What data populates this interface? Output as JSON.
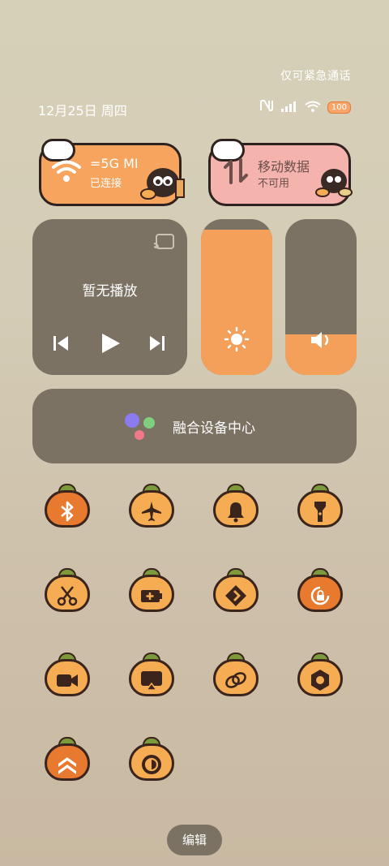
{
  "status_bar": {
    "emergency_text": "仅可紧急通话",
    "date": "12月25日 周四",
    "battery": "100",
    "icons": [
      "nfc-icon",
      "signal-icon",
      "wifi-icon",
      "battery-icon"
    ]
  },
  "wifi_tile": {
    "name": "=5G   MI",
    "status": "已连接"
  },
  "data_tile": {
    "name": "移动数据",
    "status": "不可用"
  },
  "media": {
    "label": "暂无播放"
  },
  "sliders": {
    "brightness_level": 0.93,
    "volume_level": 0.26
  },
  "device_center": {
    "label": "融合设备中心"
  },
  "quick_toggles": [
    {
      "icon": "bluetooth-icon",
      "active": true
    },
    {
      "icon": "airplane-icon",
      "active": false
    },
    {
      "icon": "bell-icon",
      "active": false
    },
    {
      "icon": "flashlight-icon",
      "active": false
    },
    {
      "icon": "scissors-icon",
      "active": false
    },
    {
      "icon": "battery-saver-icon",
      "active": false
    },
    {
      "icon": "nearby-share-icon",
      "active": false
    },
    {
      "icon": "rotation-lock-icon",
      "active": true
    },
    {
      "icon": "screen-record-icon",
      "active": false
    },
    {
      "icon": "screen-cast-icon",
      "active": false
    },
    {
      "icon": "link-icon",
      "active": false
    },
    {
      "icon": "settings-icon",
      "active": false
    },
    {
      "icon": "performance-icon",
      "active": true
    },
    {
      "icon": "dark-mode-icon",
      "active": false
    }
  ],
  "edit_button": "编辑",
  "colors": {
    "orange": "#f5ac53",
    "dark_orange": "#e87a30",
    "pink": "#f4b3ac",
    "card": "#7c7264"
  }
}
